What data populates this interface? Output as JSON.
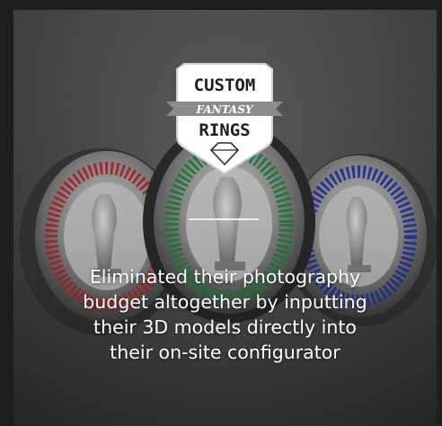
{
  "logo": {
    "line1": "CUSTOM",
    "line2": "FANTASY",
    "line3": "RINGS"
  },
  "caption": {
    "lines": [
      "Eliminated their photography",
      "budget altogether by inputting",
      "their 3D models directly into",
      "their on-site configurator"
    ]
  },
  "colors": {
    "caption_text": "#ffffff",
    "divider": "#f2f2f2",
    "ring_left_stones": "#b8343a",
    "ring_center_stones": "#2f8a4a",
    "ring_right_stones": "#2f3fa8"
  }
}
